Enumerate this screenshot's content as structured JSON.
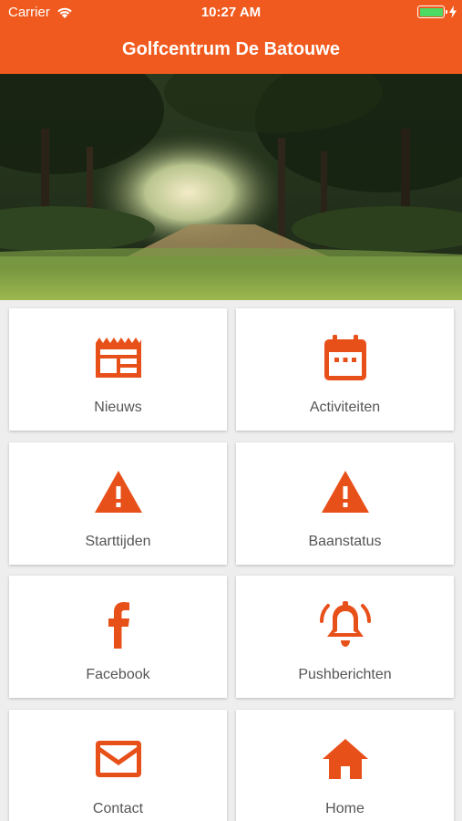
{
  "status_bar": {
    "carrier": "Carrier",
    "time": "10:27 AM"
  },
  "header": {
    "title": "Golfcentrum De Batouwe"
  },
  "colors": {
    "accent": "#f05a1e",
    "tile_icon": "#e8501a",
    "battery": "#4cd964"
  },
  "menu": [
    {
      "label": "Nieuws",
      "icon": "newspaper-icon"
    },
    {
      "label": "Activiteiten",
      "icon": "calendar-icon"
    },
    {
      "label": "Starttijden",
      "icon": "warning-icon"
    },
    {
      "label": "Baanstatus",
      "icon": "warning-icon"
    },
    {
      "label": "Facebook",
      "icon": "facebook-icon"
    },
    {
      "label": "Pushberichten",
      "icon": "bell-icon"
    },
    {
      "label": "Contact",
      "icon": "mail-icon"
    },
    {
      "label": "Home",
      "icon": "home-icon"
    }
  ]
}
